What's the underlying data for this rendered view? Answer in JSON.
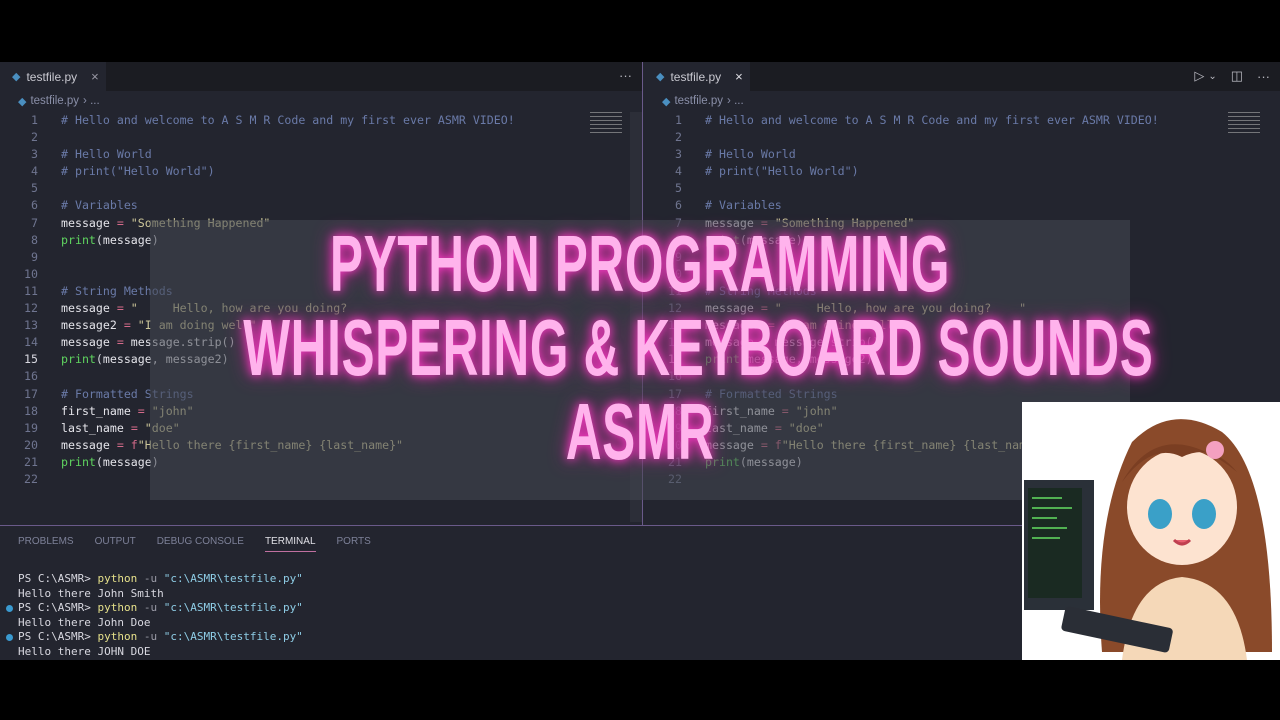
{
  "left_pane": {
    "tab": "testfile.py",
    "close": "×",
    "more": "···",
    "breadcrumb_file": "testfile.py",
    "breadcrumb_rest": "› ..."
  },
  "right_pane": {
    "tab": "testfile.py",
    "close": "×",
    "run": "▷",
    "run_dropdown": "⌄",
    "split": "◫",
    "more": "···",
    "breadcrumb_file": "testfile.py",
    "breadcrumb_rest": "› ..."
  },
  "code_left": [
    [
      [
        "c",
        "# Hello and welcome to A S M R Code and my first ever ASMR VIDEO!"
      ]
    ],
    [],
    [
      [
        "c",
        "# Hello World"
      ]
    ],
    [
      [
        "c",
        "# print(\"Hello World\")"
      ]
    ],
    [],
    [
      [
        "c",
        "# Variables"
      ]
    ],
    [
      [
        "v",
        "message "
      ],
      [
        "o",
        "="
      ],
      [
        "s",
        " \"Something Happened\""
      ]
    ],
    [
      [
        "f",
        "print"
      ],
      [
        "p",
        "("
      ],
      [
        "v",
        "message"
      ],
      [
        "p",
        ")"
      ]
    ],
    [],
    [],
    [
      [
        "c",
        "# String Methods"
      ]
    ],
    [
      [
        "v",
        "message "
      ],
      [
        "o",
        "="
      ],
      [
        "s",
        " \"     Hello, how are you doing?"
      ]
    ],
    [
      [
        "v",
        "message2 "
      ],
      [
        "o",
        "="
      ],
      [
        "s",
        " \"I am doing well\""
      ]
    ],
    [
      [
        "v",
        "message "
      ],
      [
        "o",
        "="
      ],
      [
        "v",
        " message.strip()"
      ]
    ],
    [
      [
        "f",
        "print"
      ],
      [
        "p",
        "("
      ],
      [
        "v",
        "message, message2"
      ],
      [
        "p",
        ")"
      ]
    ],
    [],
    [
      [
        "c",
        "# Formatted Strings"
      ]
    ],
    [
      [
        "v",
        "first_name "
      ],
      [
        "o",
        "="
      ],
      [
        "s",
        " \"john\""
      ]
    ],
    [
      [
        "v",
        "last_name "
      ],
      [
        "o",
        "="
      ],
      [
        "s",
        " \"doe\""
      ]
    ],
    [
      [
        "v",
        "message "
      ],
      [
        "o",
        "="
      ],
      [
        "o",
        " f"
      ],
      [
        "s",
        "\"Hello there {first_name} {last_name}\""
      ]
    ],
    [
      [
        "f",
        "print"
      ],
      [
        "p",
        "("
      ],
      [
        "v",
        "message"
      ],
      [
        "p",
        ")"
      ]
    ],
    []
  ],
  "code_right": [
    [
      [
        "c",
        "# Hello and welcome to A S M R Code and my first ever ASMR VIDEO!"
      ]
    ],
    [],
    [
      [
        "c",
        "# Hello World"
      ]
    ],
    [
      [
        "c",
        "# print(\"Hello World\")"
      ]
    ],
    [],
    [
      [
        "c",
        "# Variables"
      ]
    ],
    [
      [
        "v",
        "message "
      ],
      [
        "o",
        "="
      ],
      [
        "s",
        " \"Something Happened\""
      ]
    ],
    [
      [
        "f",
        "print"
      ],
      [
        "p",
        "("
      ],
      [
        "v",
        "message"
      ],
      [
        "p",
        ")"
      ]
    ],
    [],
    [],
    [
      [
        "c",
        "# String Methods"
      ]
    ],
    [
      [
        "v",
        "message "
      ],
      [
        "o",
        "="
      ],
      [
        "s",
        " \"     Hello, how are you doing?    \""
      ]
    ],
    [
      [
        "v",
        "message2 "
      ],
      [
        "o",
        "="
      ],
      [
        "s",
        " \"I am doing well\""
      ]
    ],
    [
      [
        "v",
        "message "
      ],
      [
        "o",
        "="
      ],
      [
        "v",
        " message.strip()"
      ]
    ],
    [
      [
        "f",
        "print"
      ],
      [
        "p",
        "("
      ],
      [
        "v",
        "message, message2"
      ],
      [
        "p",
        ")"
      ]
    ],
    [],
    [
      [
        "c",
        "# Formatted Strings"
      ]
    ],
    [
      [
        "v",
        "first_name "
      ],
      [
        "o",
        "="
      ],
      [
        "s",
        " \"john\""
      ]
    ],
    [
      [
        "v",
        "last_name "
      ],
      [
        "o",
        "="
      ],
      [
        "s",
        " \"doe\""
      ]
    ],
    [
      [
        "v",
        "message "
      ],
      [
        "o",
        "="
      ],
      [
        "o",
        " f"
      ],
      [
        "s",
        "\"Hello there {first_name} {last_name}\""
      ]
    ],
    [
      [
        "f",
        "print"
      ],
      [
        "p",
        "("
      ],
      [
        "v",
        "message"
      ],
      [
        "p",
        ")"
      ]
    ],
    []
  ],
  "current_line": 15,
  "panel": {
    "tabs": [
      "PROBLEMS",
      "OUTPUT",
      "DEBUG CONSOLE",
      "TERMINAL",
      "PORTS"
    ],
    "active_tab": "TERMINAL"
  },
  "terminal": [
    {
      "dot": false,
      "parts": [
        [
          "p",
          "PS C:\\ASMR> "
        ],
        [
          "y",
          "python"
        ],
        [
          "g",
          " -u "
        ],
        [
          "q",
          "\"c:\\ASMR\\testfile.py\""
        ]
      ]
    },
    {
      "dot": false,
      "parts": [
        [
          "p",
          "Hello there John Smith"
        ]
      ]
    },
    {
      "dot": true,
      "parts": [
        [
          "p",
          "PS C:\\ASMR> "
        ],
        [
          "y",
          "python"
        ],
        [
          "g",
          " -u "
        ],
        [
          "q",
          "\"c:\\ASMR\\testfile.py\""
        ]
      ]
    },
    {
      "dot": false,
      "parts": [
        [
          "p",
          "Hello there John Doe"
        ]
      ]
    },
    {
      "dot": true,
      "parts": [
        [
          "p",
          "PS C:\\ASMR> "
        ],
        [
          "y",
          "python"
        ],
        [
          "g",
          " -u "
        ],
        [
          "q",
          "\"c:\\ASMR\\testfile.py\""
        ]
      ]
    },
    {
      "dot": false,
      "parts": [
        [
          "p",
          "Hello there JOHN DOE"
        ]
      ]
    }
  ],
  "title": {
    "line1": "PYTHON PROGRAMMING",
    "line2": "WHISPERING & KEYBOARD SOUNDS",
    "line3": "ASMR"
  },
  "colors": {
    "title": "#ffb3ec",
    "glow": "#ff3cc8",
    "editor_bg": "#23252f"
  }
}
